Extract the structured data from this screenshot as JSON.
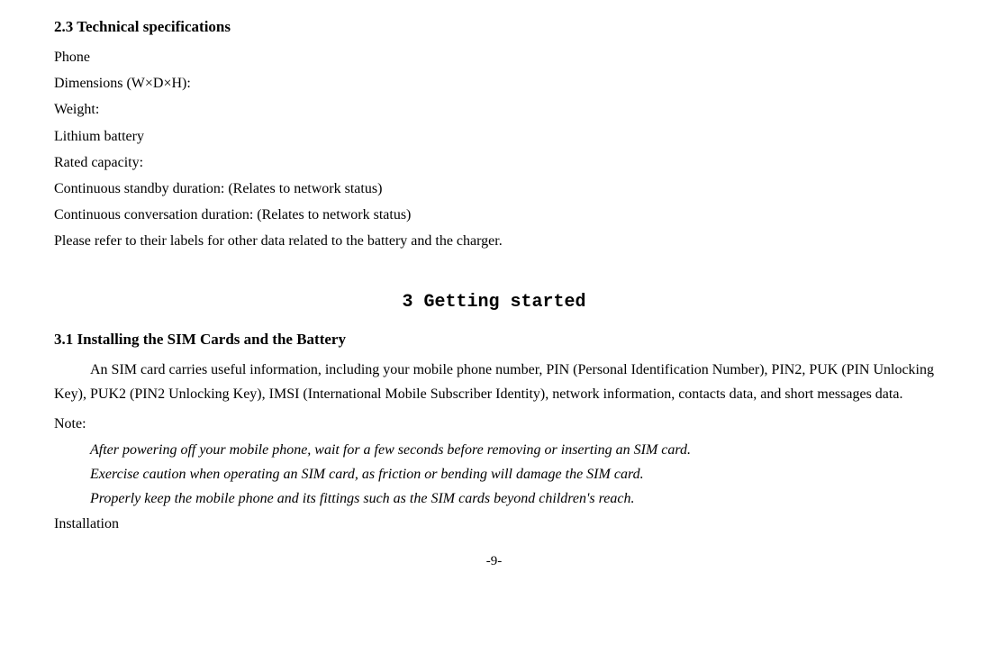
{
  "section2_3": {
    "heading": "2.3    Technical specifications",
    "phone_label": "Phone",
    "dimensions_label": "Dimensions (W×D×H):",
    "weight_label": "Weight:",
    "battery_label": "Lithium battery",
    "rated_capacity_label": "Rated capacity:",
    "standby_label": "Continuous standby duration: (Relates to network status)",
    "conversation_label": "Continuous conversation duration: (Relates to network status)",
    "refer_label": "Please refer to their labels for other data related to the battery and the charger."
  },
  "chapter3": {
    "heading": "3   Getting started"
  },
  "section3_1": {
    "heading": "3.1    Installing the SIM Cards and the Battery",
    "paragraph1": "An SIM card carries useful information, including your mobile phone number, PIN (Personal Identification Number), PIN2, PUK (PIN Unlocking Key), PUK2 (PIN2 Unlocking Key), IMSI (International Mobile Subscriber Identity), network information, contacts data, and short messages data.",
    "note_label": "Note:",
    "note1": "After powering off your mobile phone, wait for a few seconds before removing or inserting an SIM card.",
    "note2": "Exercise caution when operating an SIM card, as friction or bending will damage the SIM card.",
    "note3": "Properly keep the mobile phone and its fittings such as the SIM cards beyond children's reach.",
    "installation_label": "Installation"
  },
  "page_number": "-9-"
}
